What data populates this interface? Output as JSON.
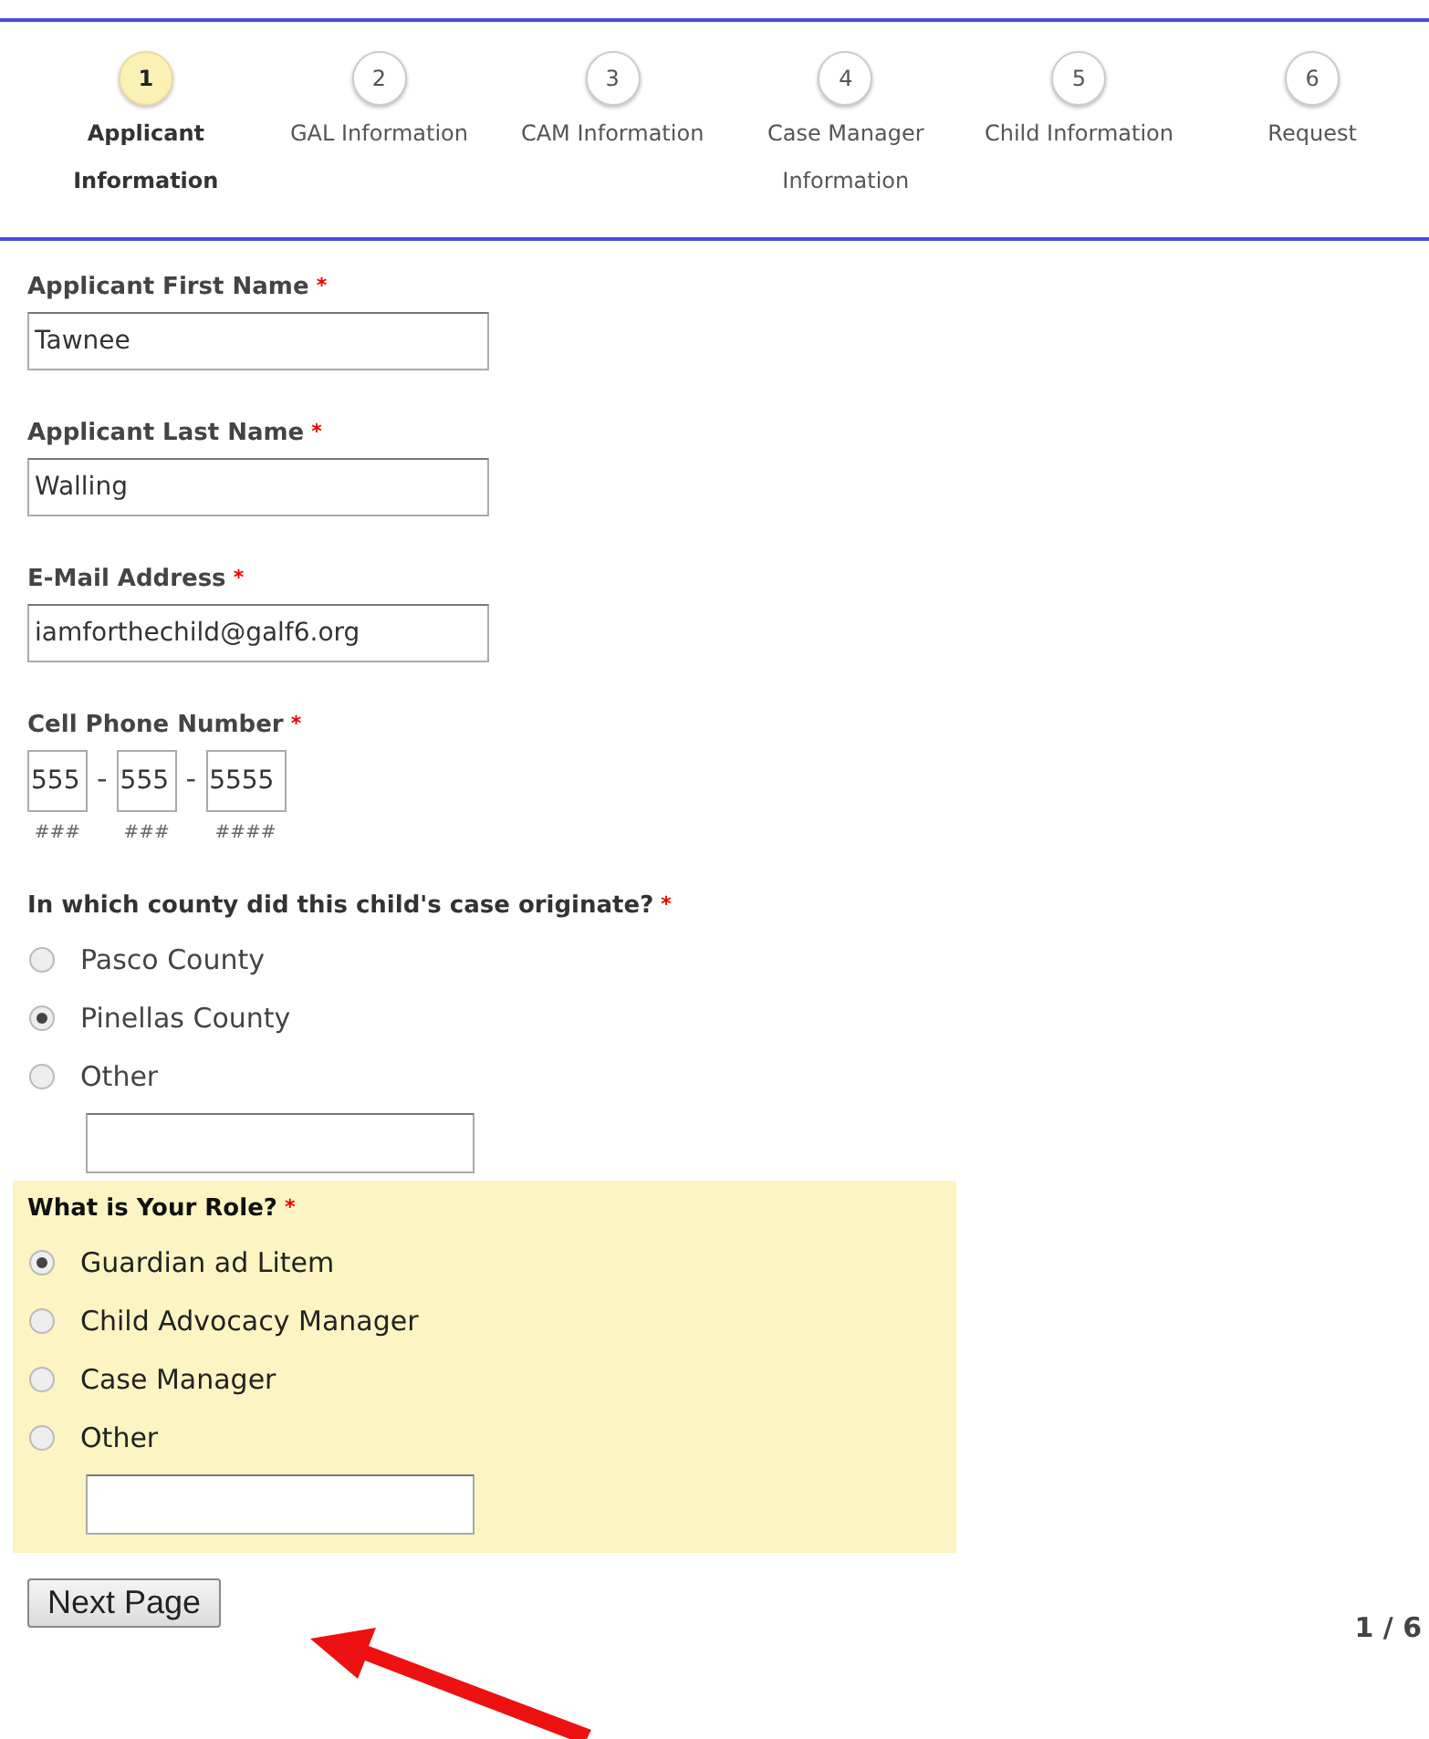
{
  "steps": [
    {
      "number": "1",
      "label": "Applicant Information",
      "selected": true
    },
    {
      "number": "2",
      "label": "GAL Information",
      "selected": false
    },
    {
      "number": "3",
      "label": "CAM Information",
      "selected": false
    },
    {
      "number": "4",
      "label": "Case Manager Information",
      "selected": false
    },
    {
      "number": "5",
      "label": "Child Information",
      "selected": false
    },
    {
      "number": "6",
      "label": "Request",
      "selected": false
    }
  ],
  "required_mark": "*",
  "text_fields": [
    {
      "label": "Applicant First Name",
      "value": "Tawnee"
    },
    {
      "label": "Applicant Last Name",
      "value": "Walling"
    },
    {
      "label": "E-Mail Address",
      "value": "iamforthechild@galf6.org"
    }
  ],
  "phone": {
    "label": "Cell Phone Number",
    "separator": "-",
    "parts": [
      {
        "value": "555",
        "hint": "###"
      },
      {
        "value": "555",
        "hint": "###"
      },
      {
        "value": "5555",
        "hint": "####"
      }
    ]
  },
  "radio_groups": [
    {
      "question": "In which county did this child's case originate?",
      "highlighted": false,
      "options": [
        {
          "label": "Pasco County",
          "selected": false
        },
        {
          "label": "Pinellas County",
          "selected": true
        },
        {
          "label": "Other",
          "selected": false
        }
      ]
    },
    {
      "question": "What is Your Role?",
      "highlighted": true,
      "options": [
        {
          "label": "Guardian ad Litem",
          "selected": true
        },
        {
          "label": "Child Advocacy Manager",
          "selected": false
        },
        {
          "label": "Case Manager",
          "selected": false
        },
        {
          "label": "Other",
          "selected": false
        }
      ]
    }
  ],
  "next_button": "Next Page",
  "page_indicator": "1 / 6"
}
